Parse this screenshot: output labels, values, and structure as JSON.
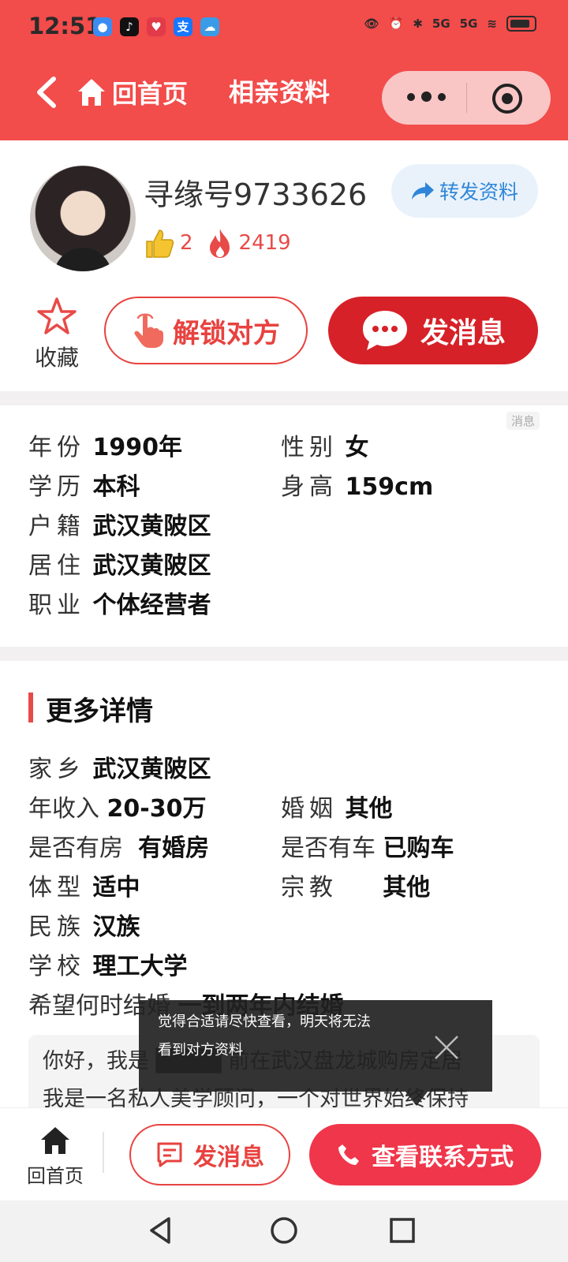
{
  "status_bar": {
    "time": "12:51",
    "app_icons": [
      {
        "name": "message-app-icon",
        "glyph": "●",
        "color": "#3b8cf2"
      },
      {
        "name": "tiktok-app-icon",
        "glyph": "♪",
        "color": "#111111"
      },
      {
        "name": "red-app-icon",
        "glyph": "♥",
        "color": "#e23a48"
      },
      {
        "name": "alipay-app-icon",
        "glyph": "支",
        "color": "#1677ff"
      },
      {
        "name": "weather-app-icon",
        "glyph": "☁",
        "color": "#3a9ce8"
      }
    ],
    "network_1": "5G",
    "network_2": "5G"
  },
  "nav": {
    "home_label": "回首页",
    "title": "相亲资料"
  },
  "profile": {
    "id_text": "寻缘号9733626",
    "share_label": "转发资料",
    "likes": "2",
    "heat": "2419",
    "favorite_label": "收藏",
    "unlock_label": "解锁对方",
    "message_label": "发消息"
  },
  "info": {
    "tag": "消息",
    "fields": {
      "year": {
        "label": "年份",
        "value": "1990年"
      },
      "gender": {
        "label": "性别",
        "value": "女"
      },
      "education": {
        "label": "学历",
        "value": "本科"
      },
      "height": {
        "label": "身高",
        "value": "159cm"
      },
      "household": {
        "label": "户籍",
        "value": "武汉黄陂区"
      },
      "residence": {
        "label": "居住",
        "value": "武汉黄陂区"
      },
      "occupation": {
        "label": "职业",
        "value": "个体经营者"
      }
    }
  },
  "more": {
    "title": "更多详情",
    "fields": {
      "hometown": {
        "label": "家乡",
        "value": "武汉黄陂区"
      },
      "income": {
        "label": "年收入",
        "value": "20-30万"
      },
      "marriage": {
        "label": "婚姻",
        "value": "其他"
      },
      "house": {
        "label": "是否有房",
        "value": "有婚房"
      },
      "car": {
        "label": "是否有车",
        "value": "已购车"
      },
      "body": {
        "label": "体型",
        "value": "适中"
      },
      "religion": {
        "label": "宗教",
        "value": "其他"
      },
      "ethnicity": {
        "label": "民族",
        "value": "汉族"
      },
      "school": {
        "label": "学校",
        "value": "理工大学"
      },
      "when_marry": {
        "label": "希望何时结婚",
        "value": "一到两年内结婚"
      }
    },
    "intro_line1": "你好，我是 ████ 前在武汉盘龙城购房定居",
    "intro_line2": "我是一名私人美学顾问，一个对世界始终保持"
  },
  "toast": {
    "line1": "觉得合适请尽快查看，明天将无法",
    "line2": "看到对方资料"
  },
  "bottom_bar": {
    "home_label": "回首页",
    "message_label": "发消息",
    "contact_label": "查看联系方式"
  }
}
